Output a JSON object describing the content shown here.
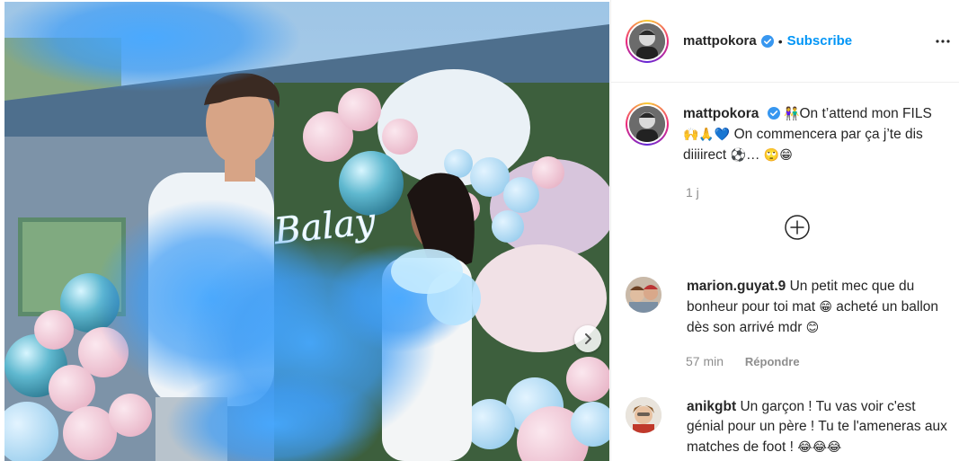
{
  "post": {
    "username": "mattpokora",
    "follow_label": "Subscribe",
    "separator": "•",
    "caption_username": "mattpokora",
    "caption_emoji_1": "👫",
    "caption_text_1": "On t’attend mon FILS",
    "caption_emoji_2": "🙌🙏💙",
    "caption_text_2": "On commencera par ça j’te dis diiiirect",
    "caption_emoji_3": "⚽",
    "caption_text_3": "…",
    "caption_emoji_4": "🙄😁",
    "time": "1 j",
    "image_neon_text": "Balay"
  },
  "comments": [
    {
      "username": "marion.guyat.9",
      "text_1": "Un petit mec que du bonheur pour toi mat",
      "emoji_1": "😁",
      "text_2": "acheté un ballon dès son arrivé mdr",
      "emoji_2": "😊",
      "time": "57 min",
      "reply_label": "Répondre"
    },
    {
      "username": "anikgbt",
      "text_1": "Un garçon ! Tu vas voir c'est génial pour un père ! Tu te l'ameneras aux matches de foot !",
      "emoji_1": "😂😂😂"
    }
  ],
  "colors": {
    "accent": "#0095f6",
    "verified": "#3897f0",
    "muted": "#8e8e8e",
    "text": "#262626"
  },
  "icons": {
    "verified": "verified-badge-icon",
    "more": "more-options-icon",
    "next": "chevron-right-icon",
    "load_more": "plus-circle-icon"
  }
}
